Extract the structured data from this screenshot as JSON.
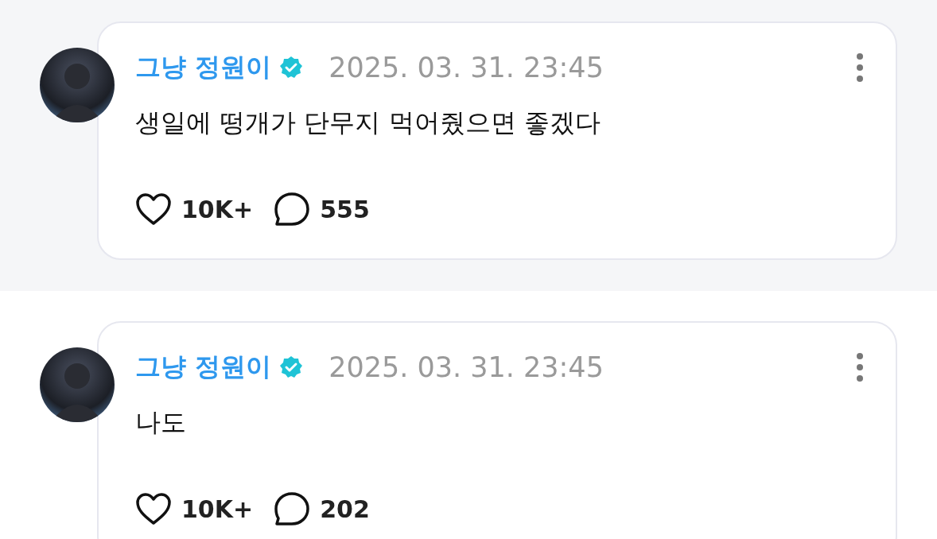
{
  "posts": [
    {
      "author": "그냥 정원이",
      "verified": true,
      "date": "2025. 03. 31. 23:45",
      "text": "생일에 떵개가 단무지 먹어줬으면 좋겠다",
      "likes": "10K+",
      "comments": "555",
      "shaded": true
    },
    {
      "author": "그냥 정원이",
      "verified": true,
      "date": "2025. 03. 31. 23:45",
      "text": "나도",
      "likes": "10K+",
      "comments": "202",
      "shaded": false
    }
  ]
}
